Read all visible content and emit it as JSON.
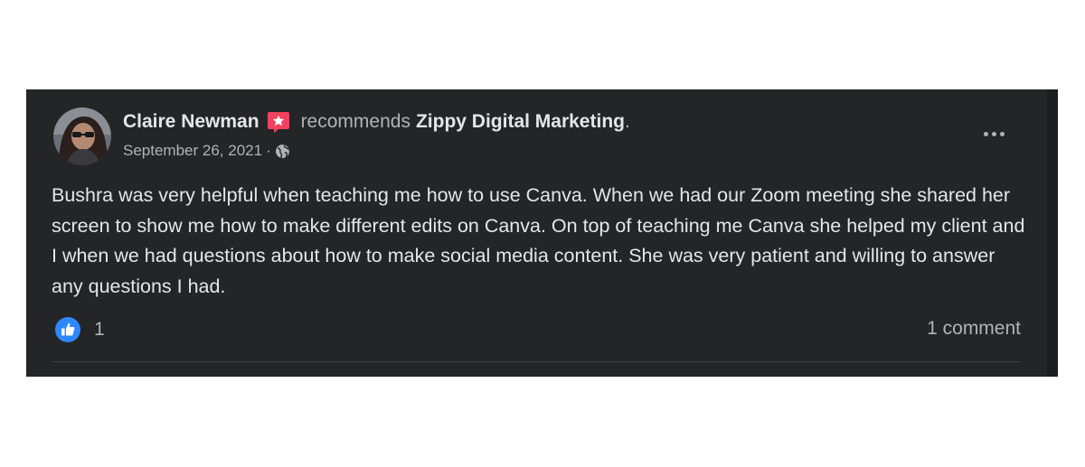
{
  "post": {
    "author": "Claire Newman",
    "verb": "recommends",
    "page_name": "Zippy Digital Marketing",
    "period": ".",
    "date": "September 26, 2021",
    "separator": "·",
    "privacy_icon": "globe-icon",
    "badge_icon": "recommendation-star-icon",
    "more_icon": "more-options-icon",
    "text": "Bushra was very helpful when teaching me how to use Canva. When we had our Zoom meeting she shared her screen to show me how to make different edits on Canva. On top of teaching me Canva she helped my client and I when we had questions about how to make social media content. She was very patient and willing to answer any questions I had.",
    "like_count": "1",
    "comment_count": "1 comment"
  },
  "colors": {
    "card_background": "#242526",
    "primary_text": "#e4e6eb",
    "secondary_text": "#b0b3b8",
    "like_blue": "#2d88ff",
    "badge_red": "#f3425f"
  }
}
